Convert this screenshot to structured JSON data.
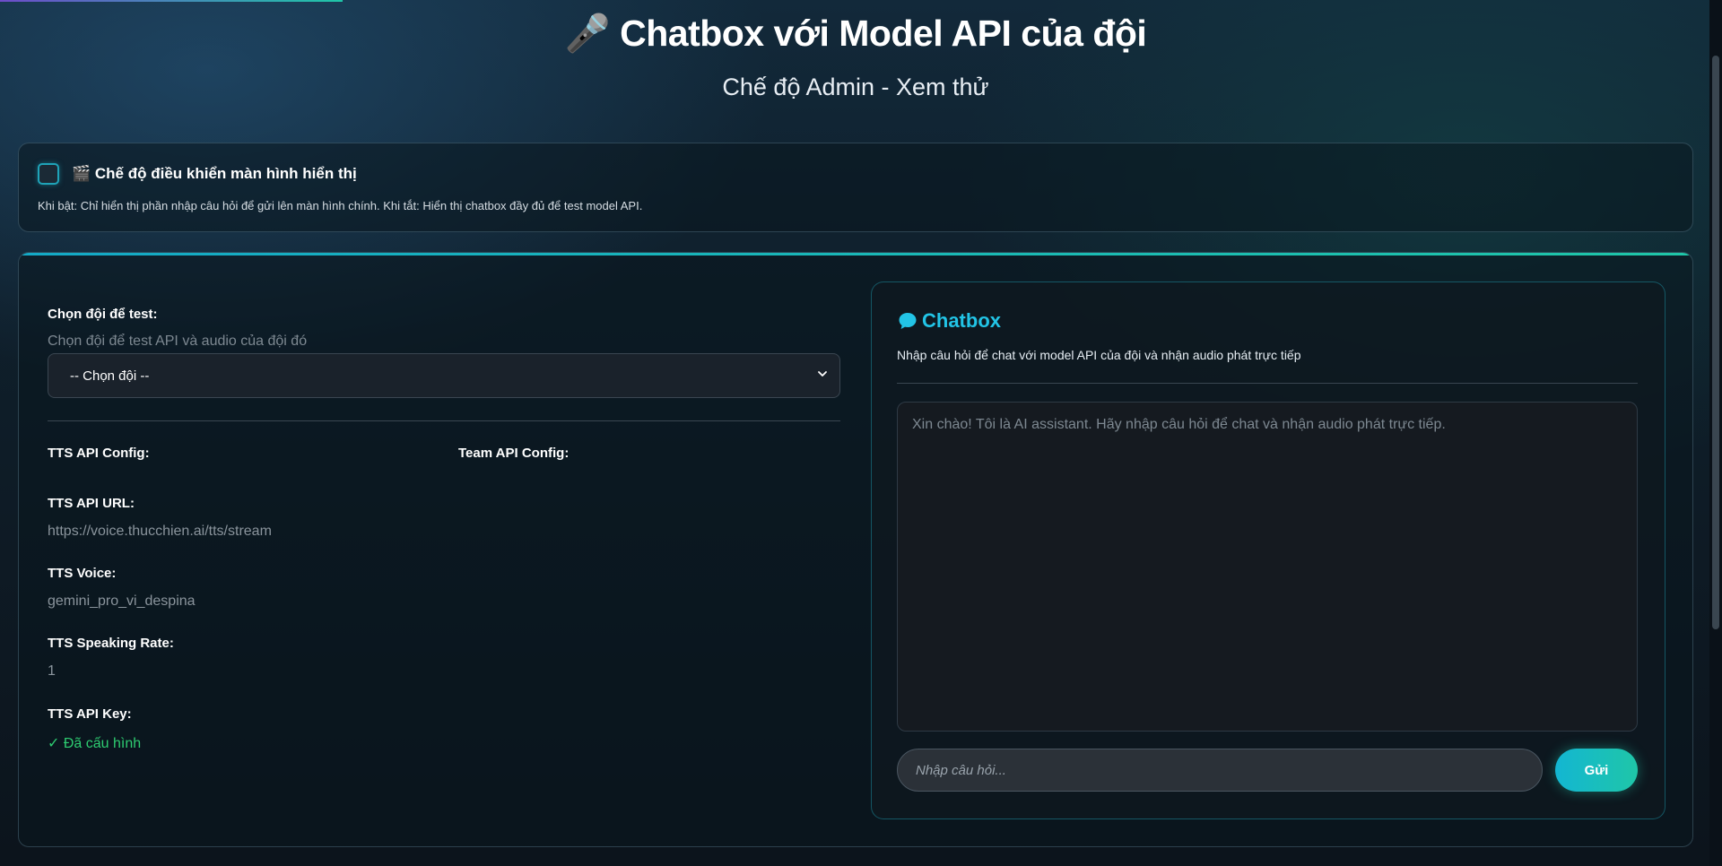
{
  "header": {
    "title": "🎤 Chatbox với Model API của đội",
    "subtitle": "Chế độ Admin - Xem thử"
  },
  "control": {
    "label": "🎬 Chế độ điều khiển màn hình hiển thị",
    "description": "Khi bật: Chỉ hiển thị phần nhập câu hỏi để gửi lên màn hình chính. Khi tắt: Hiển thị chatbox đầy đủ để test model API.",
    "checked": false
  },
  "team_select": {
    "label": "Chọn đội để test:",
    "hint": "Chọn đội để test API và audio của đội đó",
    "selected": "-- Chọn đội --"
  },
  "config": {
    "tts_heading": "TTS API Config:",
    "team_heading": "Team API Config:",
    "tts_url_label": "TTS API URL:",
    "tts_url_value": "https://voice.thucchien.ai/tts/stream",
    "tts_voice_label": "TTS Voice:",
    "tts_voice_value": "gemini_pro_vi_despina",
    "tts_rate_label": "TTS Speaking Rate:",
    "tts_rate_value": "1",
    "tts_key_label": "TTS API Key:",
    "tts_key_value": "✓ Đã cấu hình"
  },
  "chat": {
    "icon": "speech-bubble-icon",
    "title": "Chatbox",
    "description": "Nhập câu hỏi để chat với model API của đội và nhận audio phát trực tiếp",
    "welcome": "Xin chào! Tôi là AI assistant. Hãy nhập câu hỏi để chat và nhận audio phát trực tiếp.",
    "input_placeholder": "Nhập câu hỏi...",
    "input_value": "",
    "send_label": "Gửi"
  },
  "colors": {
    "accent": "#22c4e6",
    "success": "#2ecc71",
    "button_gradient_start": "#13b6d2",
    "button_gradient_end": "#1fc6a8"
  }
}
